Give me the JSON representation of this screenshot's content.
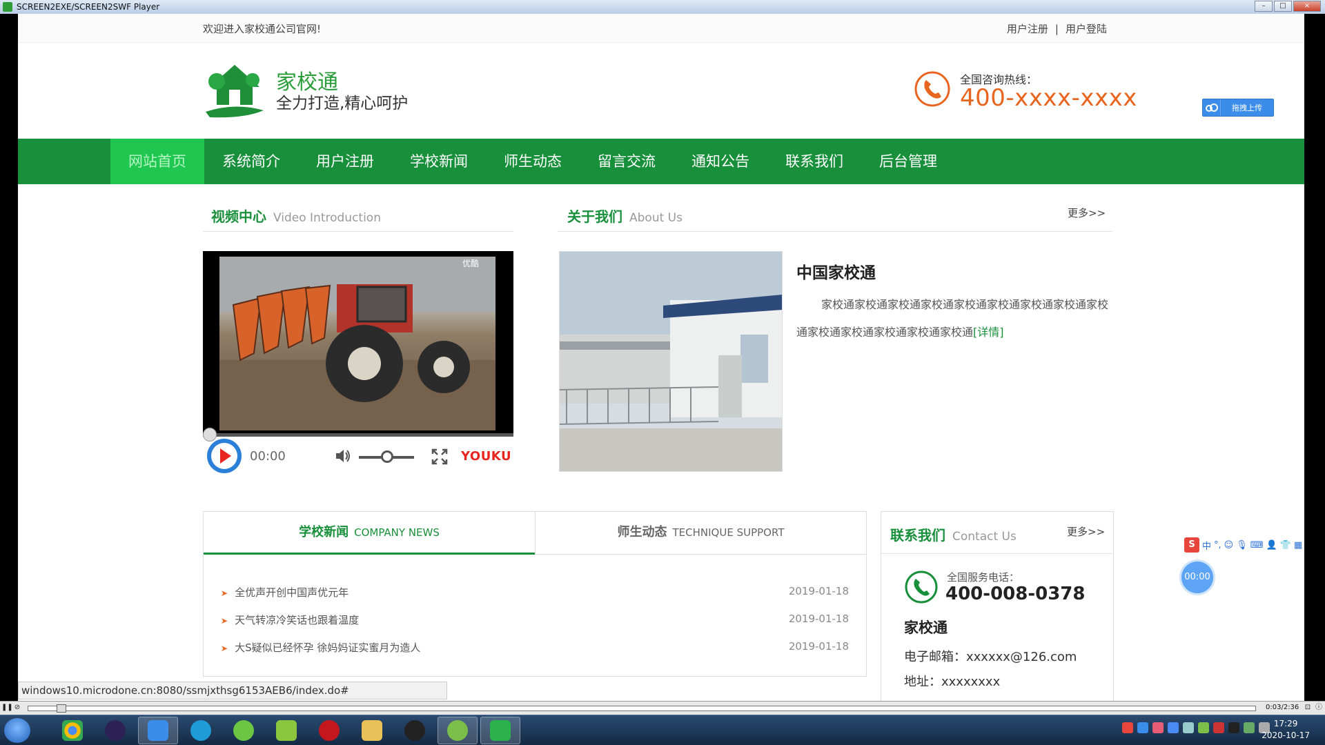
{
  "window": {
    "title": "SCREEN2EXE/SCREEN2SWF Player",
    "min_label": "–",
    "max_label": "□",
    "close_label": "×"
  },
  "topbar": {
    "welcome": "欢迎进入家校通公司官网!",
    "register": "用户注册",
    "separator": "|",
    "login": "用户登陆"
  },
  "header": {
    "brand": "家校通",
    "slogan": "全力打造,精心呵护",
    "hotline_label": "全国咨询热线：",
    "hotline_number": "400-xxxx-xxxx",
    "upload_label": "拖拽上传"
  },
  "nav": {
    "items": [
      {
        "label": "网站首页",
        "active": true
      },
      {
        "label": "系统简介",
        "active": false
      },
      {
        "label": "用户注册",
        "active": false
      },
      {
        "label": "学校新闻",
        "active": false
      },
      {
        "label": "师生动态",
        "active": false
      },
      {
        "label": "留言交流",
        "active": false
      },
      {
        "label": "通知公告",
        "active": false
      },
      {
        "label": "联系我们",
        "active": false
      },
      {
        "label": "后台管理",
        "active": false
      }
    ]
  },
  "video": {
    "title": "视频中心",
    "subtitle": "Video Introduction",
    "time": "00:00",
    "watermark": "优酷",
    "brand": "YOUKU"
  },
  "about": {
    "title": "关于我们",
    "subtitle": "About Us",
    "more": "更多>>",
    "heading": "中国家校通",
    "body": "家校通家校通家校通家校通家校通家校通家校通家校通家校通家校通家校通家校通家校通家校通",
    "detail_link": "[详情]"
  },
  "news": {
    "tab_news_cn": "学校新闻",
    "tab_news_en": "COMPANY NEWS",
    "tab_tech_cn": "师生动态",
    "tab_tech_en": "TECHNIQUE SUPPORT",
    "items": [
      {
        "title": "全优声开创中国声优元年",
        "date": "2019-01-18"
      },
      {
        "title": "天气转凉冷笑话也跟着温度",
        "date": "2019-01-18"
      },
      {
        "title": "大S疑似已经怀孕 徐妈妈证实蜜月为造人",
        "date": "2019-01-18"
      }
    ]
  },
  "contact": {
    "title": "联系我们",
    "subtitle": "Contact Us",
    "more": "更多>>",
    "service_label": "全国服务电话：",
    "service_number": "400-008-0378",
    "company": "家校通",
    "email": "电子邮箱：xxxxxx@126.com",
    "address": "地址：xxxxxxxx"
  },
  "status_url": "windows10.microdone.cn:8080/ssmjxthsg6153AEB6/index.do#",
  "ime": {
    "logo": "S",
    "mode": "中"
  },
  "float_timer": "00:00",
  "player": {
    "time": "0:03/2:36"
  },
  "taskbar": {
    "time": "17:29",
    "date": "2020-10-17"
  },
  "colors": {
    "brand_green": "#188f3a",
    "nav_active": "#1fc64f",
    "hotline_orange": "#e8651f",
    "youku_red": "#e8261f"
  }
}
